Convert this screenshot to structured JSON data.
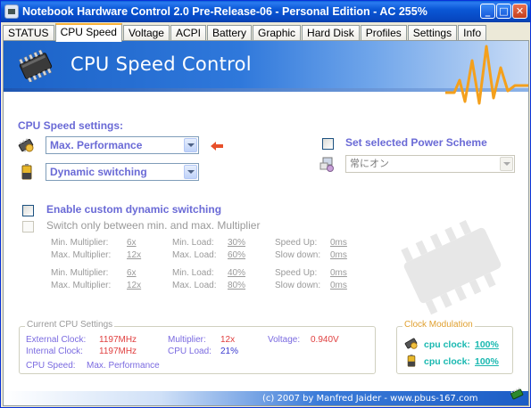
{
  "window": {
    "title": "Notebook Hardware Control 2.0 Pre-Release-06  -  Personal Edition  -  AC 255%",
    "min_glyph": "_",
    "max_glyph": "□",
    "close_glyph": "✕"
  },
  "tabs": [
    {
      "label": "STATUS"
    },
    {
      "label": "CPU Speed",
      "active": true
    },
    {
      "label": "Voltage"
    },
    {
      "label": "ACPI"
    },
    {
      "label": "Battery"
    },
    {
      "label": "Graphic"
    },
    {
      "label": "Hard Disk"
    },
    {
      "label": "Profiles"
    },
    {
      "label": "Settings"
    },
    {
      "label": "Info"
    }
  ],
  "header": {
    "title": "CPU Speed Control",
    "icon": "cpu-chip-icon"
  },
  "cpu_speed_settings": {
    "label": "CPU Speed settings:",
    "performance_value": "Max. Performance",
    "switching_value": "Dynamic switching"
  },
  "power_scheme": {
    "checkbox_label": "Set selected Power Scheme",
    "scheme_value": "常にオン",
    "checked": false
  },
  "custom_dynamic": {
    "label": "Enable custom dynamic switching",
    "checked": false,
    "switch_only_label": "Switch only between min. and max. Multiplier",
    "group1": {
      "min_mult_label": "Min. Multiplier:",
      "min_mult": "6x",
      "max_mult_label": "Max. Multiplier:",
      "max_mult": "12x",
      "min_load_label": "Min. Load:",
      "min_load": "30%",
      "max_load_label": "Max. Load:",
      "max_load": "60%",
      "speed_up_label": "Speed Up:",
      "speed_up": "0ms",
      "slow_down_label": "Slow down:",
      "slow_down": "0ms"
    },
    "group2": {
      "min_mult_label": "Min. Multiplier:",
      "min_mult": "6x",
      "max_mult_label": "Max. Multiplier:",
      "max_mult": "12x",
      "min_load_label": "Min. Load:",
      "min_load": "40%",
      "max_load_label": "Max. Load:",
      "max_load": "80%",
      "speed_up_label": "Speed Up:",
      "speed_up": "0ms",
      "slow_down_label": "Slow down:",
      "slow_down": "0ms"
    }
  },
  "current_cpu": {
    "title": "Current CPU Settings",
    "external_clock_label": "External Clock:",
    "external_clock": "1197MHz",
    "internal_clock_label": "Internal Clock:",
    "internal_clock": "1197MHz",
    "multiplier_label": "Multiplier:",
    "multiplier": "12x",
    "cpu_load_label": "CPU Load:",
    "cpu_load": "21%",
    "voltage_label": "Voltage:",
    "voltage": "0.940V",
    "cpu_speed_label": "CPU Speed:",
    "cpu_speed": "Max. Performance"
  },
  "clock_modulation": {
    "title": "Clock Modulation",
    "row1_label": "cpu clock:",
    "row1_value": "100%",
    "row2_label": "cpu clock:",
    "row2_value": "100%"
  },
  "footer": {
    "text": "(c) 2007 by Manfred Jaider - www.pbus-167.com"
  },
  "colors": {
    "accent_blue": "#6a6ad6",
    "banner_blue": "#1c63c8",
    "pulse_orange": "#f4a01c",
    "value_red": "#e04040",
    "clock_teal": "#19b8b0",
    "clock_title_orange": "#e0a030"
  }
}
